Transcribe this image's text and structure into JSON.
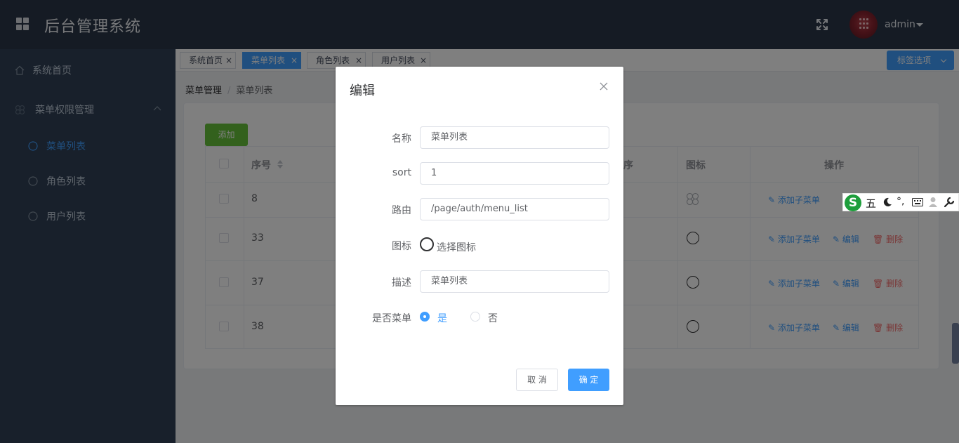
{
  "header": {
    "title": "后台管理系统",
    "user": "admin"
  },
  "sidebar": {
    "items": [
      {
        "label": "系统首页"
      },
      {
        "label": "菜单权限管理"
      },
      {
        "label": "菜单列表"
      },
      {
        "label": "角色列表"
      },
      {
        "label": "用户列表"
      }
    ]
  },
  "tags": [
    {
      "label": "系统首页",
      "close": "×"
    },
    {
      "label": "菜单列表",
      "close": "×"
    },
    {
      "label": "角色列表",
      "close": "×"
    },
    {
      "label": "用户列表",
      "close": "×"
    }
  ],
  "tag_options": "标签选项",
  "breadcrumb": {
    "parent": "菜单管理",
    "separator": "/",
    "current": "菜单列表"
  },
  "toolbar": {
    "add": "添加"
  },
  "table": {
    "headers": {
      "seq": "序号",
      "sort_col": "序",
      "icon": "图标",
      "action": "操作"
    },
    "rows": [
      {
        "seq": "8"
      },
      {
        "seq": "33"
      },
      {
        "seq": "37"
      },
      {
        "seq": "38"
      }
    ],
    "actions": {
      "add_child": "添加子菜单",
      "edit": "编辑",
      "delete": "删除"
    }
  },
  "dialog": {
    "title": "编辑",
    "fields": {
      "name_label": "名称",
      "name_value": "菜单列表",
      "sort_label": "sort",
      "sort_value": "1",
      "route_label": "路由",
      "route_value": "/page/auth/menu_list",
      "icon_label": "图标",
      "icon_value": "选择图标",
      "desc_label": "描述",
      "desc_value": "菜单列表",
      "is_menu_label": "是否菜单",
      "is_menu_yes": "是",
      "is_menu_no": "否"
    },
    "cancel": "取 消",
    "ok": "确 定"
  },
  "ime": {
    "logo": "S",
    "mode": "五",
    "punct": "°,"
  },
  "colors": {
    "primary": "#409eff",
    "success": "#67c23a",
    "danger": "#f56c6c",
    "header_bg": "#2b3648",
    "sidebar_bg": "#304156"
  }
}
